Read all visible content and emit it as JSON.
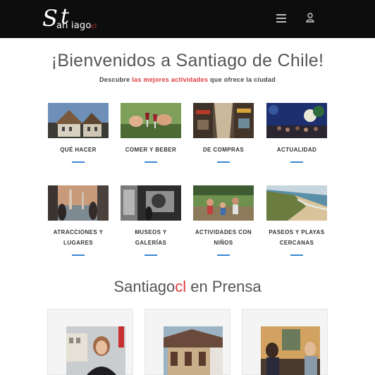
{
  "header": {
    "logo_s": "S",
    "logo_t": "t",
    "logo_rest": "an iago",
    "logo_cl": "cl",
    "menu_icon": "hamburger-menu-icon",
    "user_icon": "user-icon"
  },
  "hero": {
    "title": "¡Bienvenidos a Santiago de Chile!",
    "subtitle_pre": "Descubre ",
    "subtitle_accent": "las mejores actividades",
    "subtitle_post": " que ofrece la ciudad"
  },
  "categories": [
    {
      "label": "QUÉ HACER"
    },
    {
      "label": "COMER Y BEBER"
    },
    {
      "label": "DE COMPRAS"
    },
    {
      "label": "ACTUALIDAD"
    },
    {
      "label": "ATRACCIONES Y LUGARES"
    },
    {
      "label": "MUSEOS Y GALERÍAS"
    },
    {
      "label": "ACTIVIDADES CON NIÑOS"
    },
    {
      "label": "PASEOS Y PLAYAS CERCANAS"
    }
  ],
  "press": {
    "title_pre": "Santiago",
    "title_cl": "cl",
    "title_post": " en Prensa"
  },
  "colors": {
    "accent_red": "#e03a3e",
    "accent_blue": "#3a86d4",
    "header_bg": "#0d0d0d"
  }
}
